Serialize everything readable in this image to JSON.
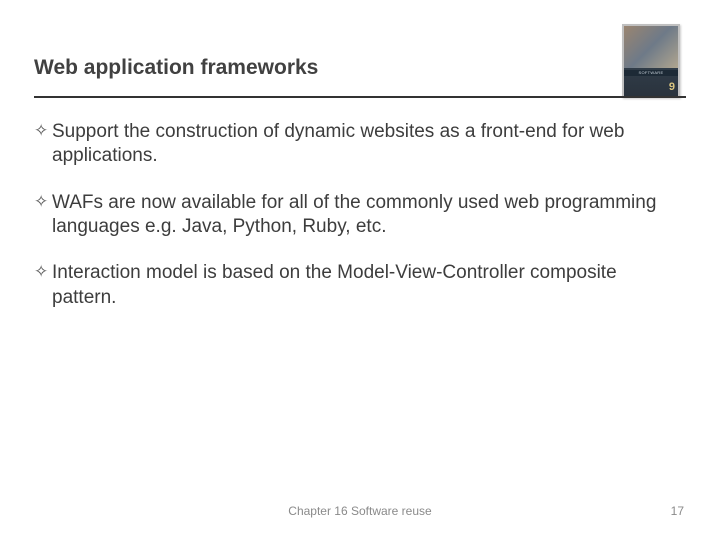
{
  "slide": {
    "title": "Web application frameworks",
    "bullets": [
      "Support the construction of dynamic websites as a front-end for web applications.",
      "WAFs are now available for all of the commonly used web programming languages e.g. Java, Python, Ruby, etc.",
      "Interaction model is based on the Model-View-Controller composite pattern."
    ],
    "footer_center": "Chapter 16 Software reuse",
    "page_number": "17",
    "book": {
      "label": "SOFTWARE ENGINEERING",
      "edition": "9"
    }
  }
}
